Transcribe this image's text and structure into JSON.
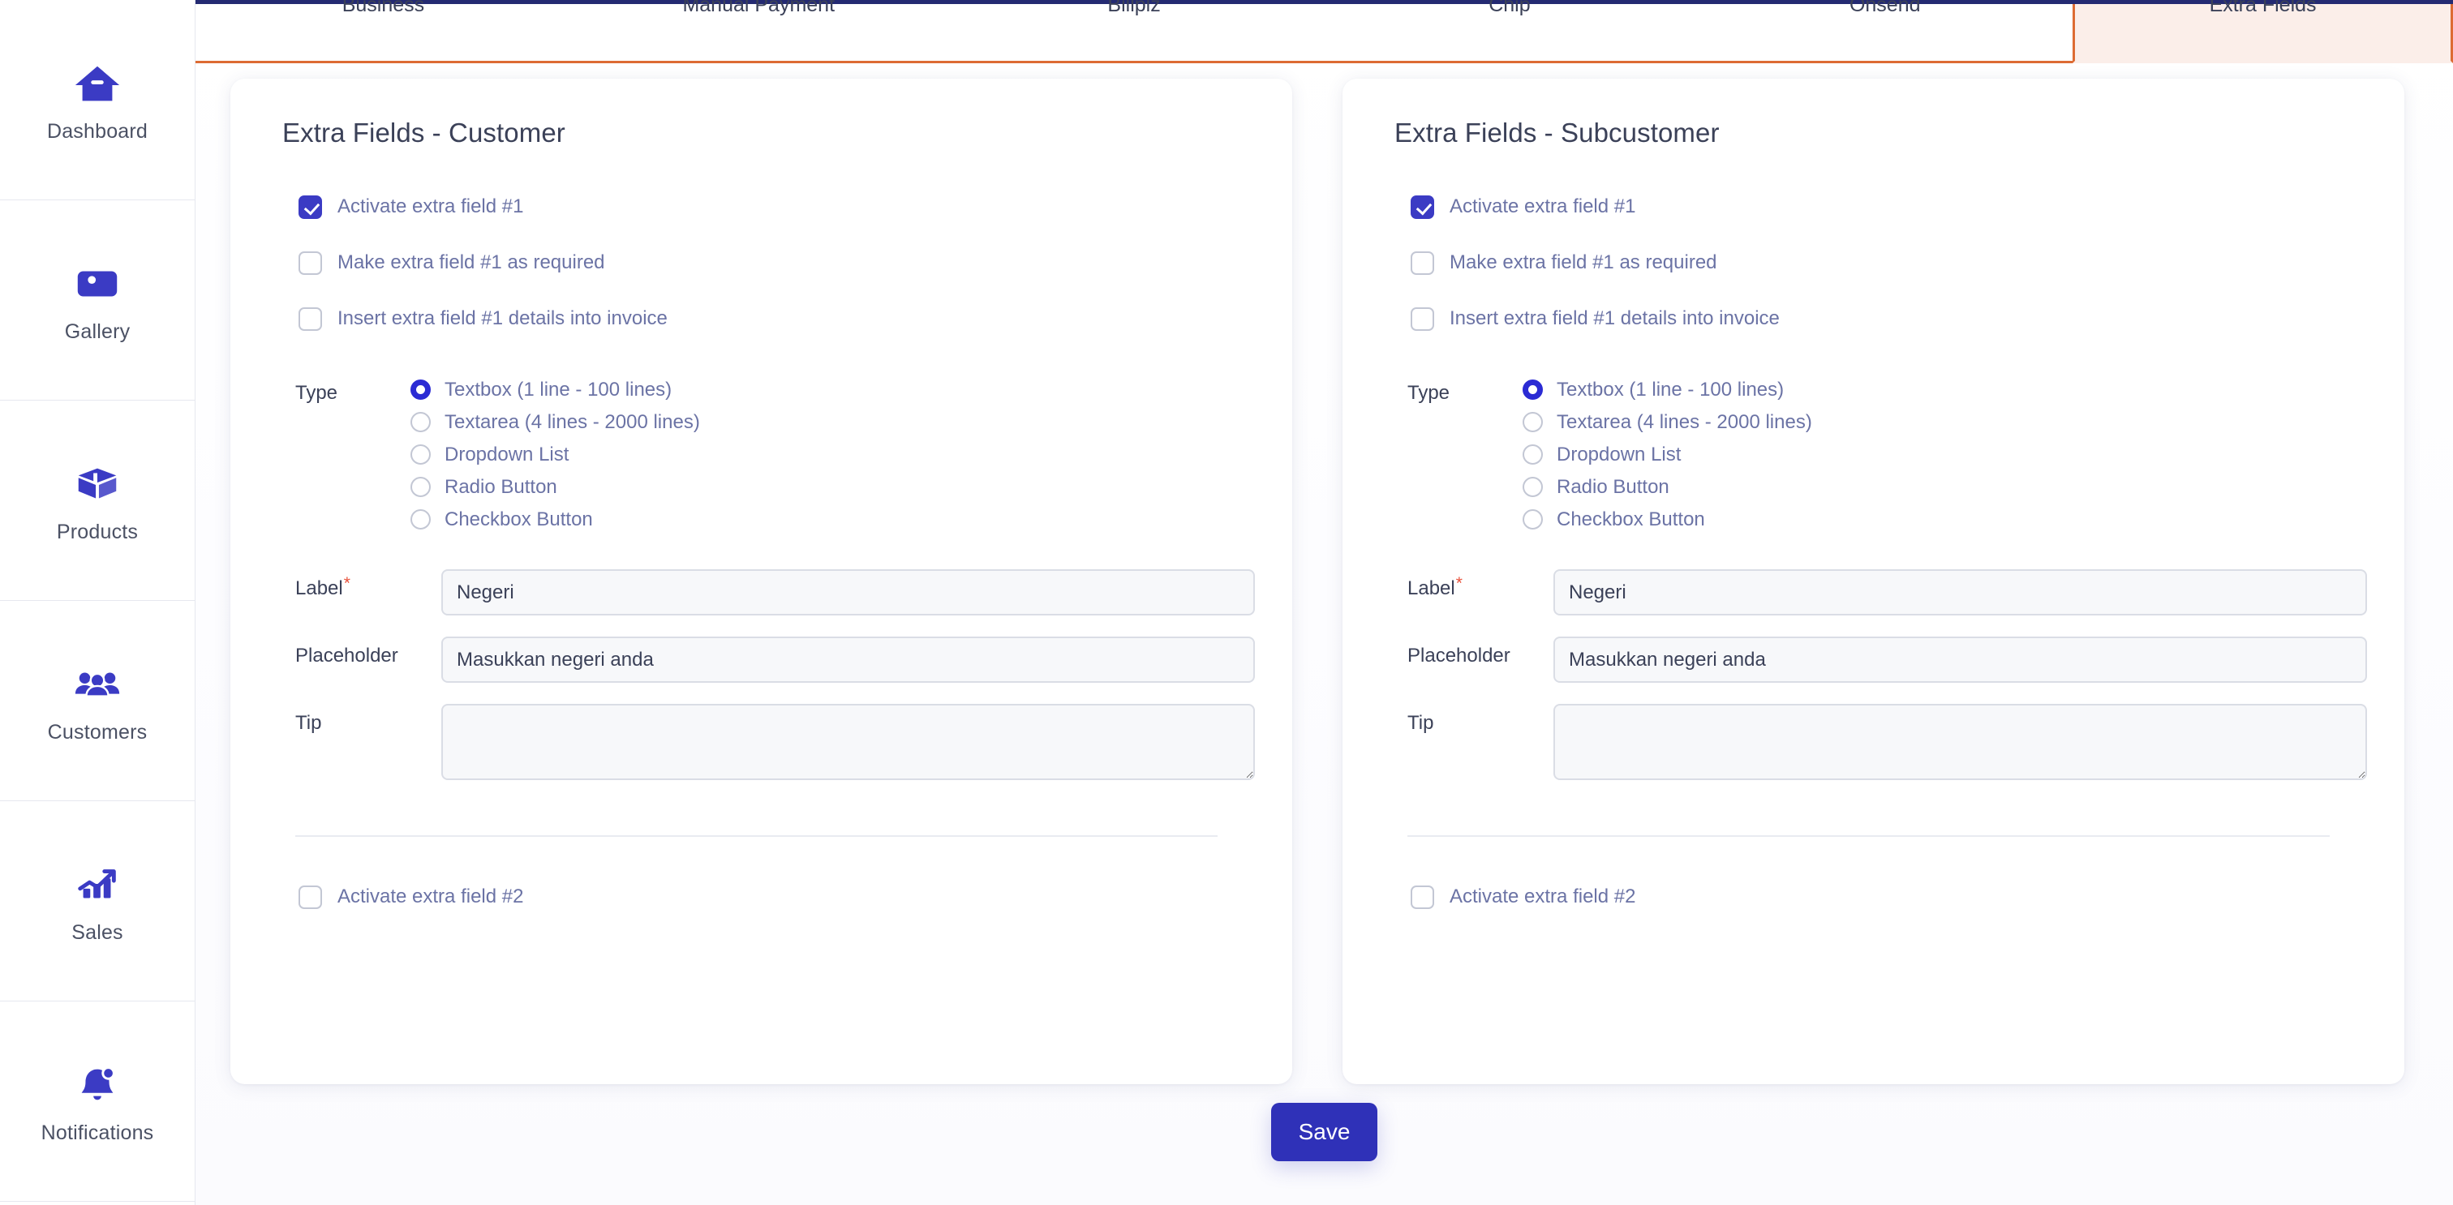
{
  "sidebar": {
    "items": [
      {
        "label": "Dashboard",
        "icon": "home-icon"
      },
      {
        "label": "Gallery",
        "icon": "image-icon"
      },
      {
        "label": "Products",
        "icon": "box-icon"
      },
      {
        "label": "Customers",
        "icon": "users-icon"
      },
      {
        "label": "Sales",
        "icon": "chart-growth-icon"
      },
      {
        "label": "Notifications",
        "icon": "bell-icon"
      }
    ]
  },
  "tabs": [
    {
      "label": "Business",
      "active": false
    },
    {
      "label": "Manual Payment",
      "active": false
    },
    {
      "label": "Billplz",
      "active": false
    },
    {
      "label": "Chip",
      "active": false
    },
    {
      "label": "Onsend",
      "active": false
    },
    {
      "label": "Extra Fields",
      "active": true
    }
  ],
  "colors": {
    "brand_blue": "#3b3bc4",
    "accent_orange": "#dd6b33",
    "active_tab_bg": "#fbeee9",
    "top_bar": "#242a72",
    "required_star": "#e8503a",
    "text_muted": "#6b73a5",
    "save_button": "#2f31b8"
  },
  "cards": [
    {
      "title": "Extra Fields - Customer",
      "checkboxes": [
        {
          "label": "Activate extra field #1",
          "checked": true
        },
        {
          "label": "Make extra field #1 as required",
          "checked": false
        },
        {
          "label": "Insert extra field #1 details into invoice",
          "checked": false
        }
      ],
      "type": {
        "label": "Type",
        "options": [
          {
            "label": "Textbox (1 line - 100 lines)",
            "selected": true
          },
          {
            "label": "Textarea (4 lines - 2000 lines)",
            "selected": false
          },
          {
            "label": "Dropdown List",
            "selected": false
          },
          {
            "label": "Radio Button",
            "selected": false
          },
          {
            "label": "Checkbox Button",
            "selected": false
          }
        ]
      },
      "fields": {
        "label": {
          "label": "Label",
          "required": true,
          "value": "Negeri",
          "placeholder": ""
        },
        "placeholder": {
          "label": "Placeholder",
          "required": false,
          "value": "Masukkan negeri anda",
          "placeholder": ""
        },
        "tip": {
          "label": "Tip",
          "required": false,
          "value": "",
          "placeholder": ""
        }
      },
      "second_checkbox": {
        "label": "Activate extra field #2",
        "checked": false
      }
    },
    {
      "title": "Extra Fields - Subcustomer",
      "checkboxes": [
        {
          "label": "Activate extra field #1",
          "checked": true
        },
        {
          "label": "Make extra field #1 as required",
          "checked": false
        },
        {
          "label": "Insert extra field #1 details into invoice",
          "checked": false
        }
      ],
      "type": {
        "label": "Type",
        "options": [
          {
            "label": "Textbox (1 line - 100 lines)",
            "selected": true
          },
          {
            "label": "Textarea (4 lines - 2000 lines)",
            "selected": false
          },
          {
            "label": "Dropdown List",
            "selected": false
          },
          {
            "label": "Radio Button",
            "selected": false
          },
          {
            "label": "Checkbox Button",
            "selected": false
          }
        ]
      },
      "fields": {
        "label": {
          "label": "Label",
          "required": true,
          "value": "Negeri",
          "placeholder": ""
        },
        "placeholder": {
          "label": "Placeholder",
          "required": false,
          "value": "Masukkan negeri anda",
          "placeholder": ""
        },
        "tip": {
          "label": "Tip",
          "required": false,
          "value": "",
          "placeholder": ""
        }
      },
      "second_checkbox": {
        "label": "Activate extra field #2",
        "checked": false
      }
    }
  ],
  "footer": {
    "save_label": "Save"
  }
}
